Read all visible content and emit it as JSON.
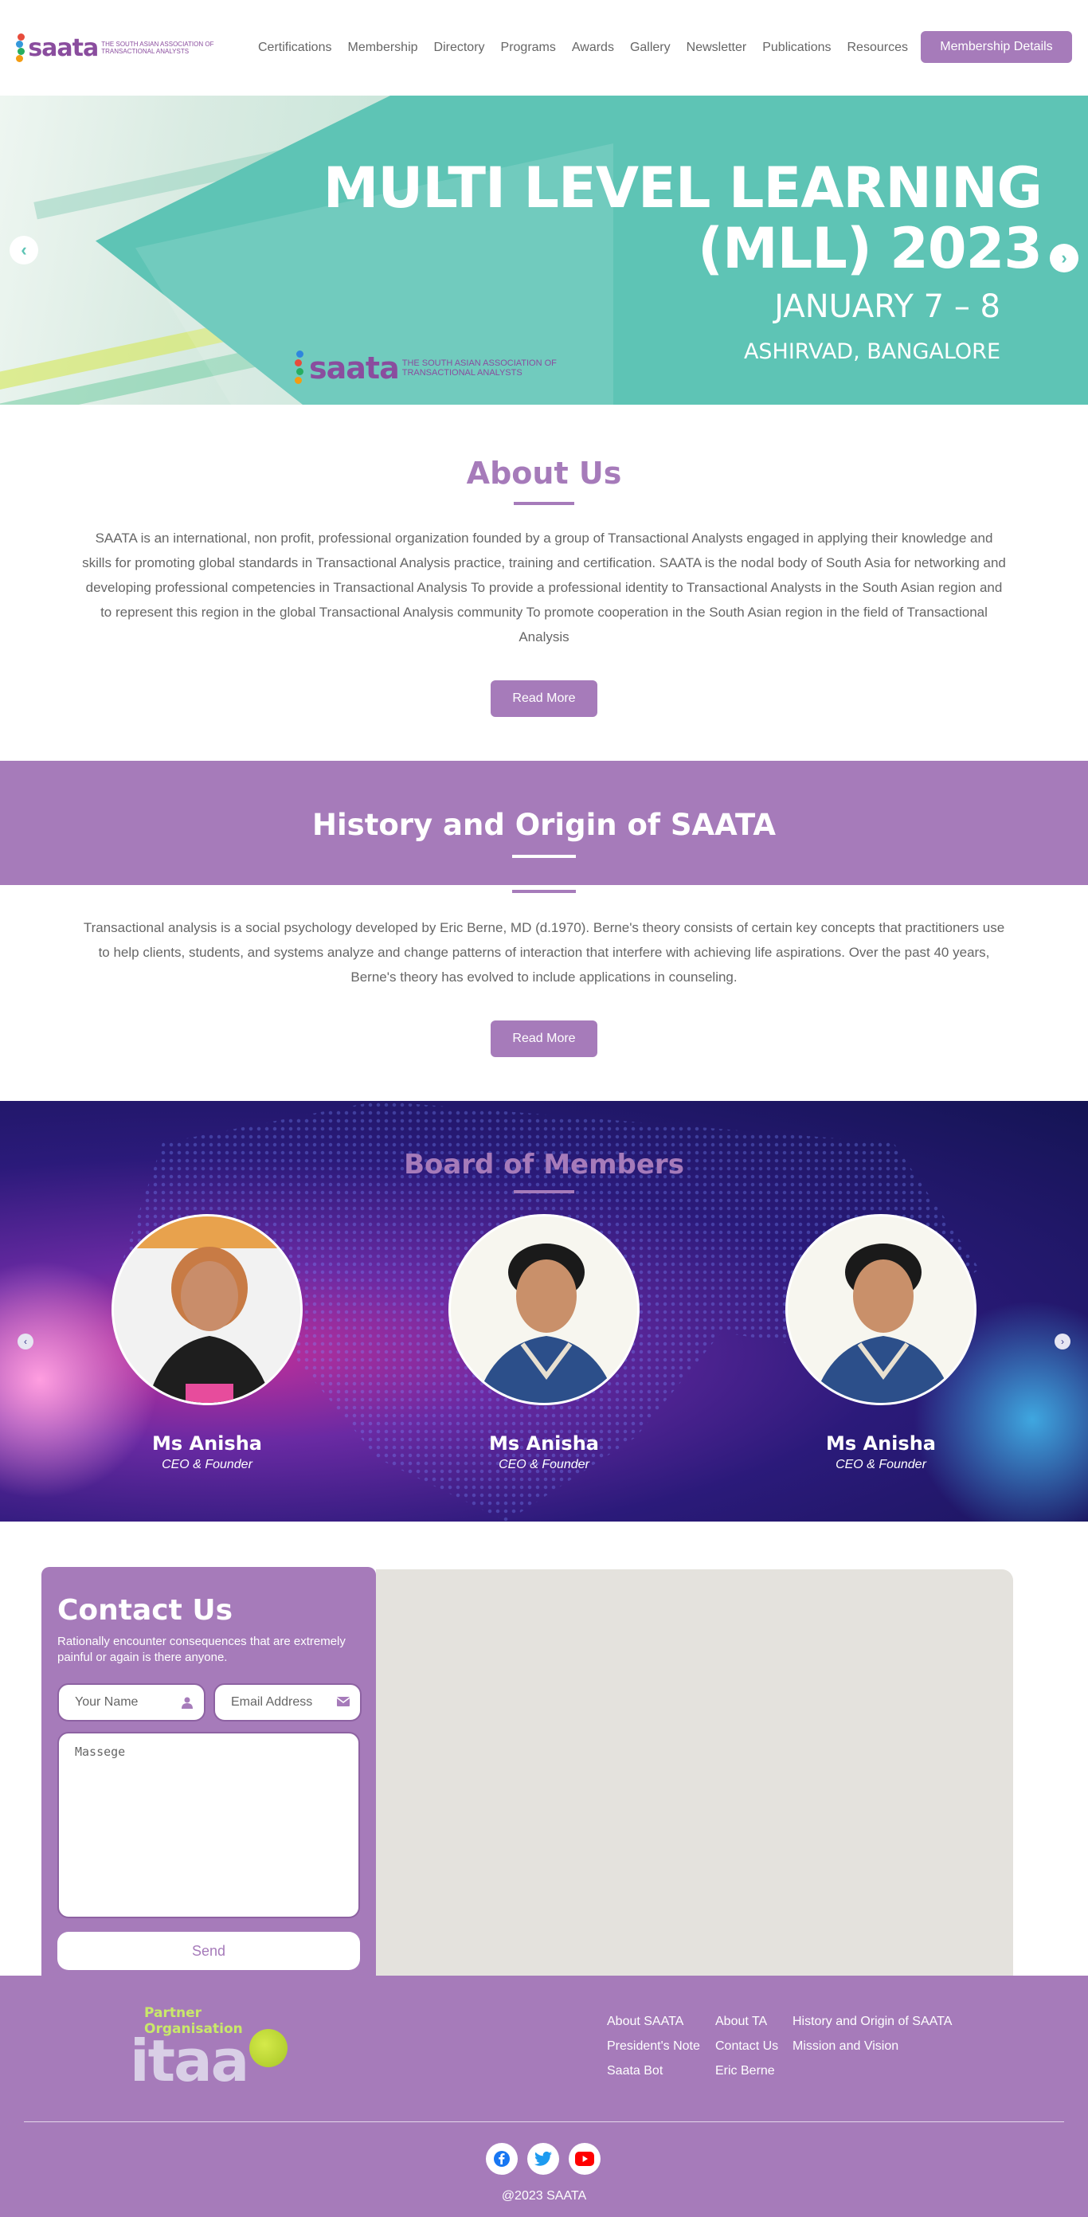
{
  "header": {
    "logo_word": "saata",
    "logo_sub": "THE SOUTH ASIAN ASSOCIATION OF TRANSACTIONAL ANALYSTS",
    "nav": [
      "Certifications",
      "Membership",
      "Directory",
      "Programs",
      "Awards",
      "Gallery",
      "Newsletter",
      "Publications",
      "Resources"
    ],
    "cta_label": "Membership Details"
  },
  "hero": {
    "title_line1": "MULTI LEVEL LEARNING",
    "title_line2": "(MLL) 2023",
    "date": "JANUARY 7 – 8",
    "place": "ASHIRVAD, BANGALORE",
    "logo_word": "saata",
    "logo_sub": "THE SOUTH ASIAN ASSOCIATION OF TRANSACTIONAL ANALYSTS",
    "prev_icon": "chevron-left-icon",
    "next_icon": "chevron-right-icon"
  },
  "about": {
    "title": "About Us",
    "text": "SAATA is an international, non profit, professional organization founded by a group of Transactional Analysts engaged in applying their knowledge and skills for promoting global standards in Transactional Analysis practice, training and certification. SAATA is the nodal body of South Asia for networking and developing professional competencies in Transactional Analysis To provide a professional identity to Transactional Analysts in the South Asian region and to represent this region in the global Transactional Analysis community To promote cooperation in the South Asian region in the field of Transactional Analysis",
    "button": "Read More"
  },
  "history": {
    "title": "History and Origin of SAATA",
    "text": "Transactional analysis is a social psychology developed by Eric Berne, MD (d.1970). Berne's theory consists of certain key concepts that practitioners use to help clients, students, and systems analyze and change patterns of interaction that interfere with achieving life aspirations. Over the past 40 years, Berne's theory has evolved to include applications in counseling.",
    "button": "Read More"
  },
  "board": {
    "title": "Board of Members",
    "members": [
      {
        "name": "Ms Anisha",
        "role": "CEO & Founder"
      },
      {
        "name": "Ms Anisha",
        "role": "CEO & Founder"
      },
      {
        "name": "Ms Anisha",
        "role": "CEO & Founder"
      }
    ]
  },
  "contact": {
    "title": "Contact Us",
    "subtitle": "Rationally encounter consequences that are extremely painful or again is there anyone.",
    "name_placeholder": "Your Name",
    "email_placeholder": "Email Address",
    "message_placeholder": "Massege",
    "send": "Send"
  },
  "footer": {
    "partner_label": "Partner Organisation",
    "partner_word": "itaa",
    "links": [
      "About SAATA",
      "About TA",
      "History and Origin of SAATA",
      "President's Note",
      "Contact Us",
      "Mission and Vision",
      "Saata Bot",
      "Eric Berne"
    ],
    "copyright": "@2023 SAATA"
  },
  "colors": {
    "accent": "#a67bba",
    "hero_teal": "#5ec4b5"
  }
}
